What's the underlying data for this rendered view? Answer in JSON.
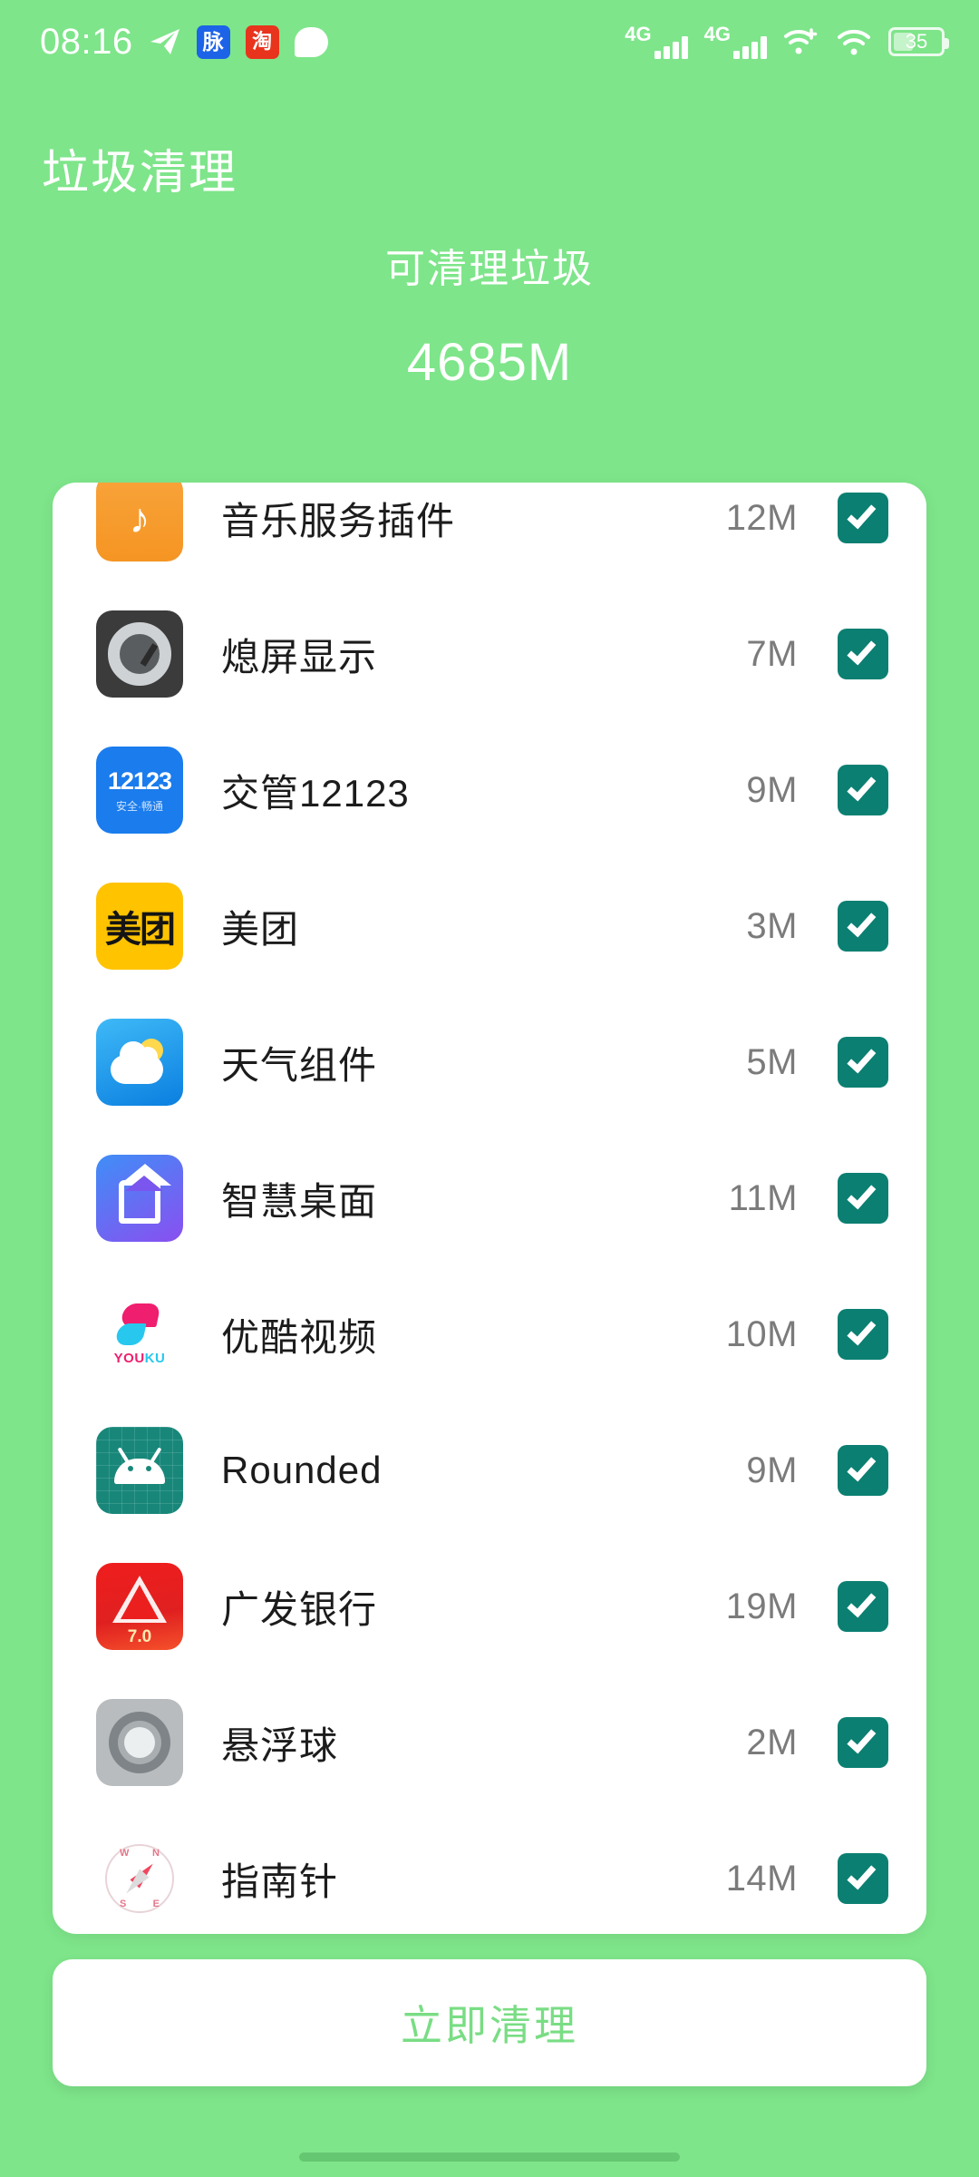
{
  "statusbar": {
    "time": "08:16",
    "left_icons": [
      {
        "name": "telegram-icon",
        "label": ""
      },
      {
        "name": "maimai-app-icon",
        "label": "脉"
      },
      {
        "name": "taobao-app-icon",
        "label": "淘"
      },
      {
        "name": "message-bubble-icon",
        "label": ""
      }
    ],
    "sim1_network": "4G",
    "sim2_network": "4G",
    "battery_level": "35"
  },
  "header": {
    "title": "垃圾清理",
    "summary_label": "可清理垃圾",
    "summary_value": "4685M"
  },
  "list": [
    {
      "icon": "music-service-plugin-icon",
      "name": "音乐服务插件",
      "size": "12M",
      "checked": true
    },
    {
      "icon": "always-on-display-icon",
      "name": "熄屏显示",
      "size": "7M",
      "checked": true
    },
    {
      "icon": "jiaoguan-12123-icon",
      "name": "交管12123",
      "size": "9M",
      "checked": true
    },
    {
      "icon": "meituan-icon",
      "name": "美团",
      "size": "3M",
      "checked": true
    },
    {
      "icon": "weather-widget-icon",
      "name": "天气组件",
      "size": "5M",
      "checked": true
    },
    {
      "icon": "smart-desktop-icon",
      "name": "智慧桌面",
      "size": "11M",
      "checked": true
    },
    {
      "icon": "youku-video-icon",
      "name": "优酷视频",
      "size": "10M",
      "checked": true
    },
    {
      "icon": "rounded-android-icon",
      "name": "Rounded",
      "size": "9M",
      "checked": true
    },
    {
      "icon": "cgb-bank-icon",
      "name": "广发银行",
      "size": "19M",
      "checked": true
    },
    {
      "icon": "floating-ball-icon",
      "name": "悬浮球",
      "size": "2M",
      "checked": true
    },
    {
      "icon": "compass-icon",
      "name": "指南针",
      "size": "14M",
      "checked": true
    }
  ],
  "icon_text": {
    "music_glyph": "♪",
    "m12123_number": "12123",
    "m12123_sub": "安全·畅通",
    "meituan_glyph": "美团",
    "youku_word_a": "YOU",
    "youku_word_b": "KU",
    "cgb_version": "7.0",
    "compass_n": "N",
    "compass_s": "S",
    "compass_w": "W",
    "compass_e": "E"
  },
  "footer": {
    "clean_button": "立即清理"
  },
  "colors": {
    "background": "#7ee58a",
    "card": "#ffffff",
    "checkbox": "#0b7f72",
    "button_text": "#79dd84",
    "size_text": "#7b7b7b"
  }
}
